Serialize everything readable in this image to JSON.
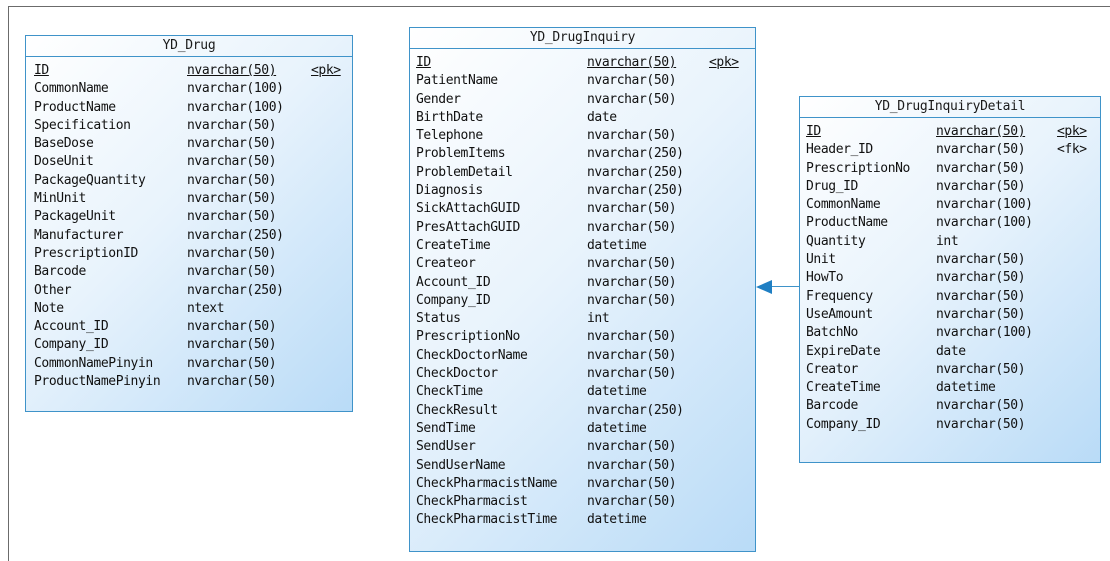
{
  "entities": {
    "drug": {
      "title": "YD_Drug",
      "columns": [
        {
          "name": "ID",
          "type": "nvarchar(50)",
          "key": "<pk>"
        },
        {
          "name": "CommonName",
          "type": "nvarchar(100)",
          "key": ""
        },
        {
          "name": "ProductName",
          "type": "nvarchar(100)",
          "key": ""
        },
        {
          "name": "Specification",
          "type": "nvarchar(50)",
          "key": ""
        },
        {
          "name": "BaseDose",
          "type": "nvarchar(50)",
          "key": ""
        },
        {
          "name": "DoseUnit",
          "type": "nvarchar(50)",
          "key": ""
        },
        {
          "name": "PackageQuantity",
          "type": "nvarchar(50)",
          "key": ""
        },
        {
          "name": "MinUnit",
          "type": "nvarchar(50)",
          "key": ""
        },
        {
          "name": "PackageUnit",
          "type": "nvarchar(50)",
          "key": ""
        },
        {
          "name": "Manufacturer",
          "type": "nvarchar(250)",
          "key": ""
        },
        {
          "name": "PrescriptionID",
          "type": "nvarchar(50)",
          "key": ""
        },
        {
          "name": "Barcode",
          "type": "nvarchar(50)",
          "key": ""
        },
        {
          "name": "Other",
          "type": "nvarchar(250)",
          "key": ""
        },
        {
          "name": "Note",
          "type": "ntext",
          "key": ""
        },
        {
          "name": "Account_ID",
          "type": "nvarchar(50)",
          "key": ""
        },
        {
          "name": "Company_ID",
          "type": "nvarchar(50)",
          "key": ""
        },
        {
          "name": "CommonNamePinyin",
          "type": "nvarchar(50)",
          "key": ""
        },
        {
          "name": "ProductNamePinyin",
          "type": "nvarchar(50)",
          "key": ""
        }
      ]
    },
    "inquiry": {
      "title": "YD_DrugInquiry",
      "columns": [
        {
          "name": "ID",
          "type": "nvarchar(50)",
          "key": "<pk>"
        },
        {
          "name": "PatientName",
          "type": "nvarchar(50)",
          "key": ""
        },
        {
          "name": "Gender",
          "type": "nvarchar(50)",
          "key": ""
        },
        {
          "name": "BirthDate",
          "type": "date",
          "key": ""
        },
        {
          "name": "Telephone",
          "type": "nvarchar(50)",
          "key": ""
        },
        {
          "name": "ProblemItems",
          "type": "nvarchar(250)",
          "key": ""
        },
        {
          "name": "ProblemDetail",
          "type": "nvarchar(250)",
          "key": ""
        },
        {
          "name": "Diagnosis",
          "type": "nvarchar(250)",
          "key": ""
        },
        {
          "name": "SickAttachGUID",
          "type": "nvarchar(50)",
          "key": ""
        },
        {
          "name": "PresAttachGUID",
          "type": "nvarchar(50)",
          "key": ""
        },
        {
          "name": "CreateTime",
          "type": "datetime",
          "key": ""
        },
        {
          "name": "Createor",
          "type": "nvarchar(50)",
          "key": ""
        },
        {
          "name": "Account_ID",
          "type": "nvarchar(50)",
          "key": ""
        },
        {
          "name": "Company_ID",
          "type": "nvarchar(50)",
          "key": ""
        },
        {
          "name": "Status",
          "type": "int",
          "key": ""
        },
        {
          "name": "PrescriptionNo",
          "type": "nvarchar(50)",
          "key": ""
        },
        {
          "name": "CheckDoctorName",
          "type": "nvarchar(50)",
          "key": ""
        },
        {
          "name": "CheckDoctor",
          "type": "nvarchar(50)",
          "key": ""
        },
        {
          "name": "CheckTime",
          "type": "datetime",
          "key": ""
        },
        {
          "name": "CheckResult",
          "type": "nvarchar(250)",
          "key": ""
        },
        {
          "name": "SendTime",
          "type": "datetime",
          "key": ""
        },
        {
          "name": "SendUser",
          "type": "nvarchar(50)",
          "key": ""
        },
        {
          "name": "SendUserName",
          "type": "nvarchar(50)",
          "key": ""
        },
        {
          "name": "CheckPharmacistName",
          "type": "nvarchar(50)",
          "key": ""
        },
        {
          "name": "CheckPharmacist",
          "type": "nvarchar(50)",
          "key": ""
        },
        {
          "name": "CheckPharmacistTime",
          "type": "datetime",
          "key": ""
        }
      ]
    },
    "detail": {
      "title": "YD_DrugInquiryDetail",
      "columns": [
        {
          "name": "ID",
          "type": "nvarchar(50)",
          "key": "<pk>"
        },
        {
          "name": "Header_ID",
          "type": "nvarchar(50)",
          "key": "<fk>"
        },
        {
          "name": "PrescriptionNo",
          "type": "nvarchar(50)",
          "key": ""
        },
        {
          "name": "Drug_ID",
          "type": "nvarchar(50)",
          "key": ""
        },
        {
          "name": "CommonName",
          "type": "nvarchar(100)",
          "key": ""
        },
        {
          "name": "ProductName",
          "type": "nvarchar(100)",
          "key": ""
        },
        {
          "name": "Quantity",
          "type": "int",
          "key": ""
        },
        {
          "name": "Unit",
          "type": "nvarchar(50)",
          "key": ""
        },
        {
          "name": "HowTo",
          "type": "nvarchar(50)",
          "key": ""
        },
        {
          "name": "Frequency",
          "type": "nvarchar(50)",
          "key": ""
        },
        {
          "name": "UseAmount",
          "type": "nvarchar(50)",
          "key": ""
        },
        {
          "name": "BatchNo",
          "type": "nvarchar(100)",
          "key": ""
        },
        {
          "name": "ExpireDate",
          "type": "date",
          "key": ""
        },
        {
          "name": "Creator",
          "type": "nvarchar(50)",
          "key": ""
        },
        {
          "name": "CreateTime",
          "type": "datetime",
          "key": ""
        },
        {
          "name": "Barcode",
          "type": "nvarchar(50)",
          "key": ""
        },
        {
          "name": "Company_ID",
          "type": "nvarchar(50)",
          "key": ""
        }
      ]
    }
  },
  "colors": {
    "border": "#3f93c9",
    "gradient_light": "#ffffff",
    "gradient_dark": "#b9dbf7"
  }
}
